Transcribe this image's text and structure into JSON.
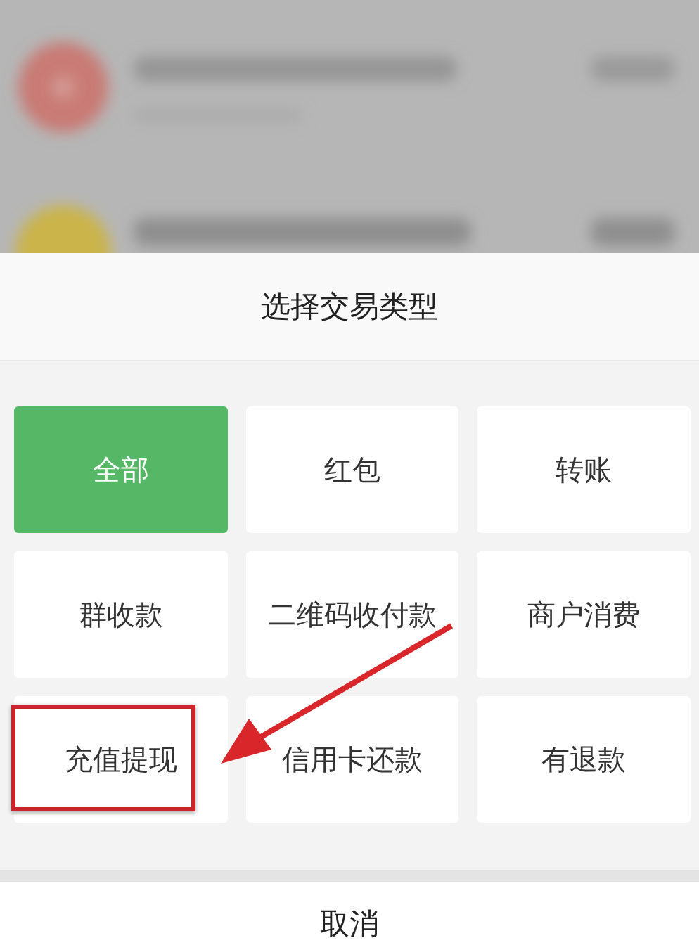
{
  "sheet": {
    "title": "选择交易类型"
  },
  "options": [
    {
      "label": "全部",
      "selected": true,
      "highlighted": false
    },
    {
      "label": "红包",
      "selected": false,
      "highlighted": false
    },
    {
      "label": "转账",
      "selected": false,
      "highlighted": false
    },
    {
      "label": "群收款",
      "selected": false,
      "highlighted": false
    },
    {
      "label": "二维码收付款",
      "selected": false,
      "highlighted": false
    },
    {
      "label": "商户消费",
      "selected": false,
      "highlighted": false
    },
    {
      "label": "充值提现",
      "selected": false,
      "highlighted": true
    },
    {
      "label": "信用卡还款",
      "selected": false,
      "highlighted": false
    },
    {
      "label": "有退款",
      "selected": false,
      "highlighted": false
    }
  ],
  "cancel_button": {
    "label": "取消"
  }
}
